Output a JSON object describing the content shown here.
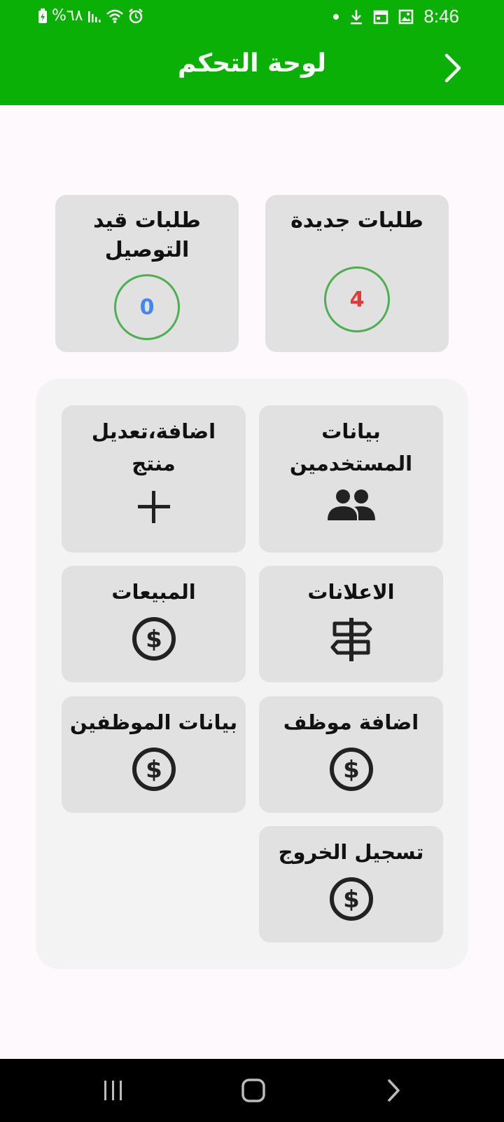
{
  "status_bar": {
    "battery_text": "%٦٨",
    "time": "8:46",
    "icons_left": [
      "battery-charging-icon",
      "signal-icon",
      "wifi-icon",
      "alarm-icon"
    ],
    "icons_right": [
      "dot-icon",
      "download-icon",
      "calendar-icon",
      "image-icon"
    ]
  },
  "app_bar": {
    "title": "لوحة التحكم",
    "back_icon": "chevron-right-icon",
    "background": "#0ab005"
  },
  "stats": {
    "new_orders": {
      "title": "طلبات جديدة",
      "value": "4",
      "value_color": "#e53935"
    },
    "delivering_orders": {
      "title": "طلبات قيد التوصيل",
      "value": "0",
      "value_color": "#4285f4"
    }
  },
  "menu": {
    "users": {
      "label": "بيانات المستخدمين",
      "icon": "people-icon"
    },
    "products": {
      "label": "اضافة،تعديل منتج",
      "icon": "plus-icon"
    },
    "ads": {
      "label": "الاعلانات",
      "icon": "signpost-icon"
    },
    "sales": {
      "label": "المبيعات",
      "icon": "dollar-icon"
    },
    "add_employee": {
      "label": "اضافة موظف",
      "icon": "dollar-icon"
    },
    "employees": {
      "label": "بيانات الموظفين",
      "icon": "dollar-icon"
    },
    "logout": {
      "label": "تسجيل الخروج",
      "icon": "dollar-icon"
    }
  },
  "nav_bar": {
    "recents": "recents-icon",
    "home": "home-icon",
    "back": "back-icon"
  }
}
